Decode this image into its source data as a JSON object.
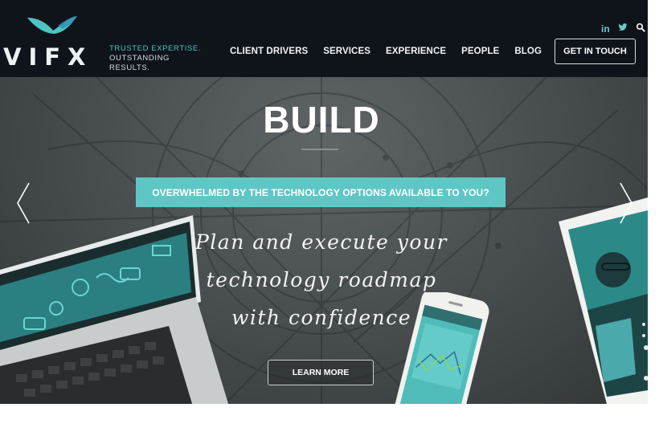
{
  "brand": {
    "name": "VIFX",
    "tagline_line1": "TRUSTED EXPERTISE.",
    "tagline_line2": "OUTSTANDING RESULTS.",
    "accent_color": "#5ec7c6"
  },
  "nav": {
    "items": [
      {
        "label": "CLIENT DRIVERS"
      },
      {
        "label": "SERVICES"
      },
      {
        "label": "EXPERIENCE"
      },
      {
        "label": "PEOPLE"
      },
      {
        "label": "BLOG"
      }
    ],
    "cta_label": "GET IN TOUCH"
  },
  "social": {
    "linkedin_label": "in",
    "icons": [
      "linkedin-icon",
      "twitter-icon",
      "search-icon"
    ]
  },
  "hero": {
    "heading": "BUILD",
    "banner": "OVERWHELMED BY THE TECHNOLOGY OPTIONS AVAILABLE TO YOU?",
    "script_lines": [
      "Plan and execute your",
      "technology roadmap",
      "with confidence"
    ],
    "button_label": "LEARN MORE",
    "prev_icon": "chevron-left-icon",
    "next_icon": "chevron-right-icon"
  }
}
